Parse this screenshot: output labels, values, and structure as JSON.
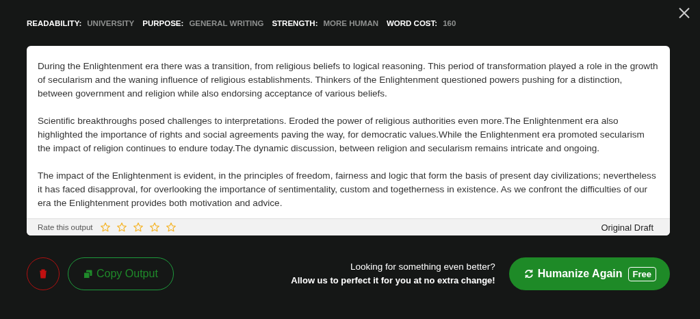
{
  "meta": [
    {
      "label": "READABILITY:",
      "value": "UNIVERSITY"
    },
    {
      "label": "PURPOSE:",
      "value": "GENERAL WRITING"
    },
    {
      "label": "STRENGTH:",
      "value": "MORE HUMAN"
    },
    {
      "label": "WORD COST:",
      "value": "160"
    }
  ],
  "paragraphs": [
    "During the Enlightenment era there was a transition, from religious beliefs to logical reasoning. This period of transformation played a role in the growth of secularism and the waning influence of religious establishments. Thinkers of the Enlightenment questioned powers pushing for a distinction, between government and religion while also endorsing acceptance of various beliefs.",
    "Scientific breakthroughs posed challenges to interpretations. Eroded the power of religious authorities even more.The Enlightenment era also highlighted the importance of rights and social agreements paving the way, for democratic values.While the Enlightenment era promoted secularism the impact of religion continues to endure today.The dynamic discussion, between religion and secularism remains intricate and ongoing.",
    "The impact of the Enlightenment is evident, in the principles of freedom, fairness and logic that form the basis of present day civilizations; nevertheless it has faced disapproval, for overlooking the importance of sentimentality, custom and togetherness in existence. As we confront the difficulties of our era the Enlightenment provides both motivation and advice."
  ],
  "rating": {
    "label": "Rate this output",
    "stars": 0
  },
  "draft_label": "Original Draft",
  "copy_button": "Copy Output",
  "promo": {
    "line1": "Looking for something even better?",
    "line2": "Allow us to perfect it for you at no extra change!"
  },
  "humanize_button": {
    "label": "Humanize Again",
    "badge": "Free"
  }
}
